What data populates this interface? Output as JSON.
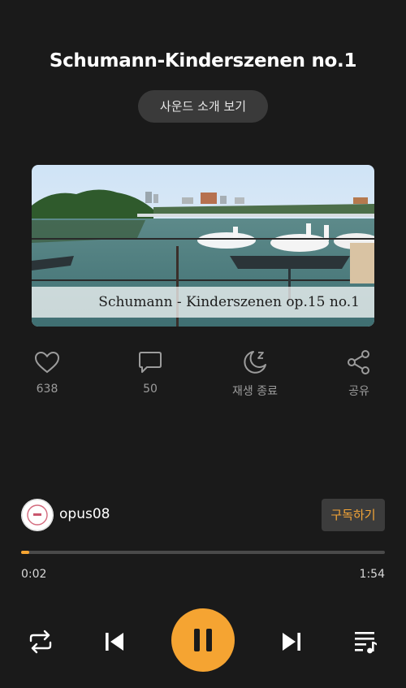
{
  "track": {
    "title": "Schumann-Kinderszenen no.1",
    "intro_button": "사운드 소개 보기",
    "cover_caption": "Schumann - Kinderszenen op.15 no.1"
  },
  "actions": [
    {
      "icon": "heart-icon",
      "label": "638"
    },
    {
      "icon": "comment-icon",
      "label": "50"
    },
    {
      "icon": "sleep-timer-icon",
      "label": "재생 종료"
    },
    {
      "icon": "share-icon",
      "label": "공유"
    }
  ],
  "channel": {
    "name": "opus08",
    "subscribe_label": "구독하기"
  },
  "playback": {
    "current_time": "0:02",
    "total_time": "1:54",
    "progress_fraction": 0.017,
    "state": "playing"
  },
  "colors": {
    "accent": "#f5a432",
    "background": "#1a1a1a"
  }
}
